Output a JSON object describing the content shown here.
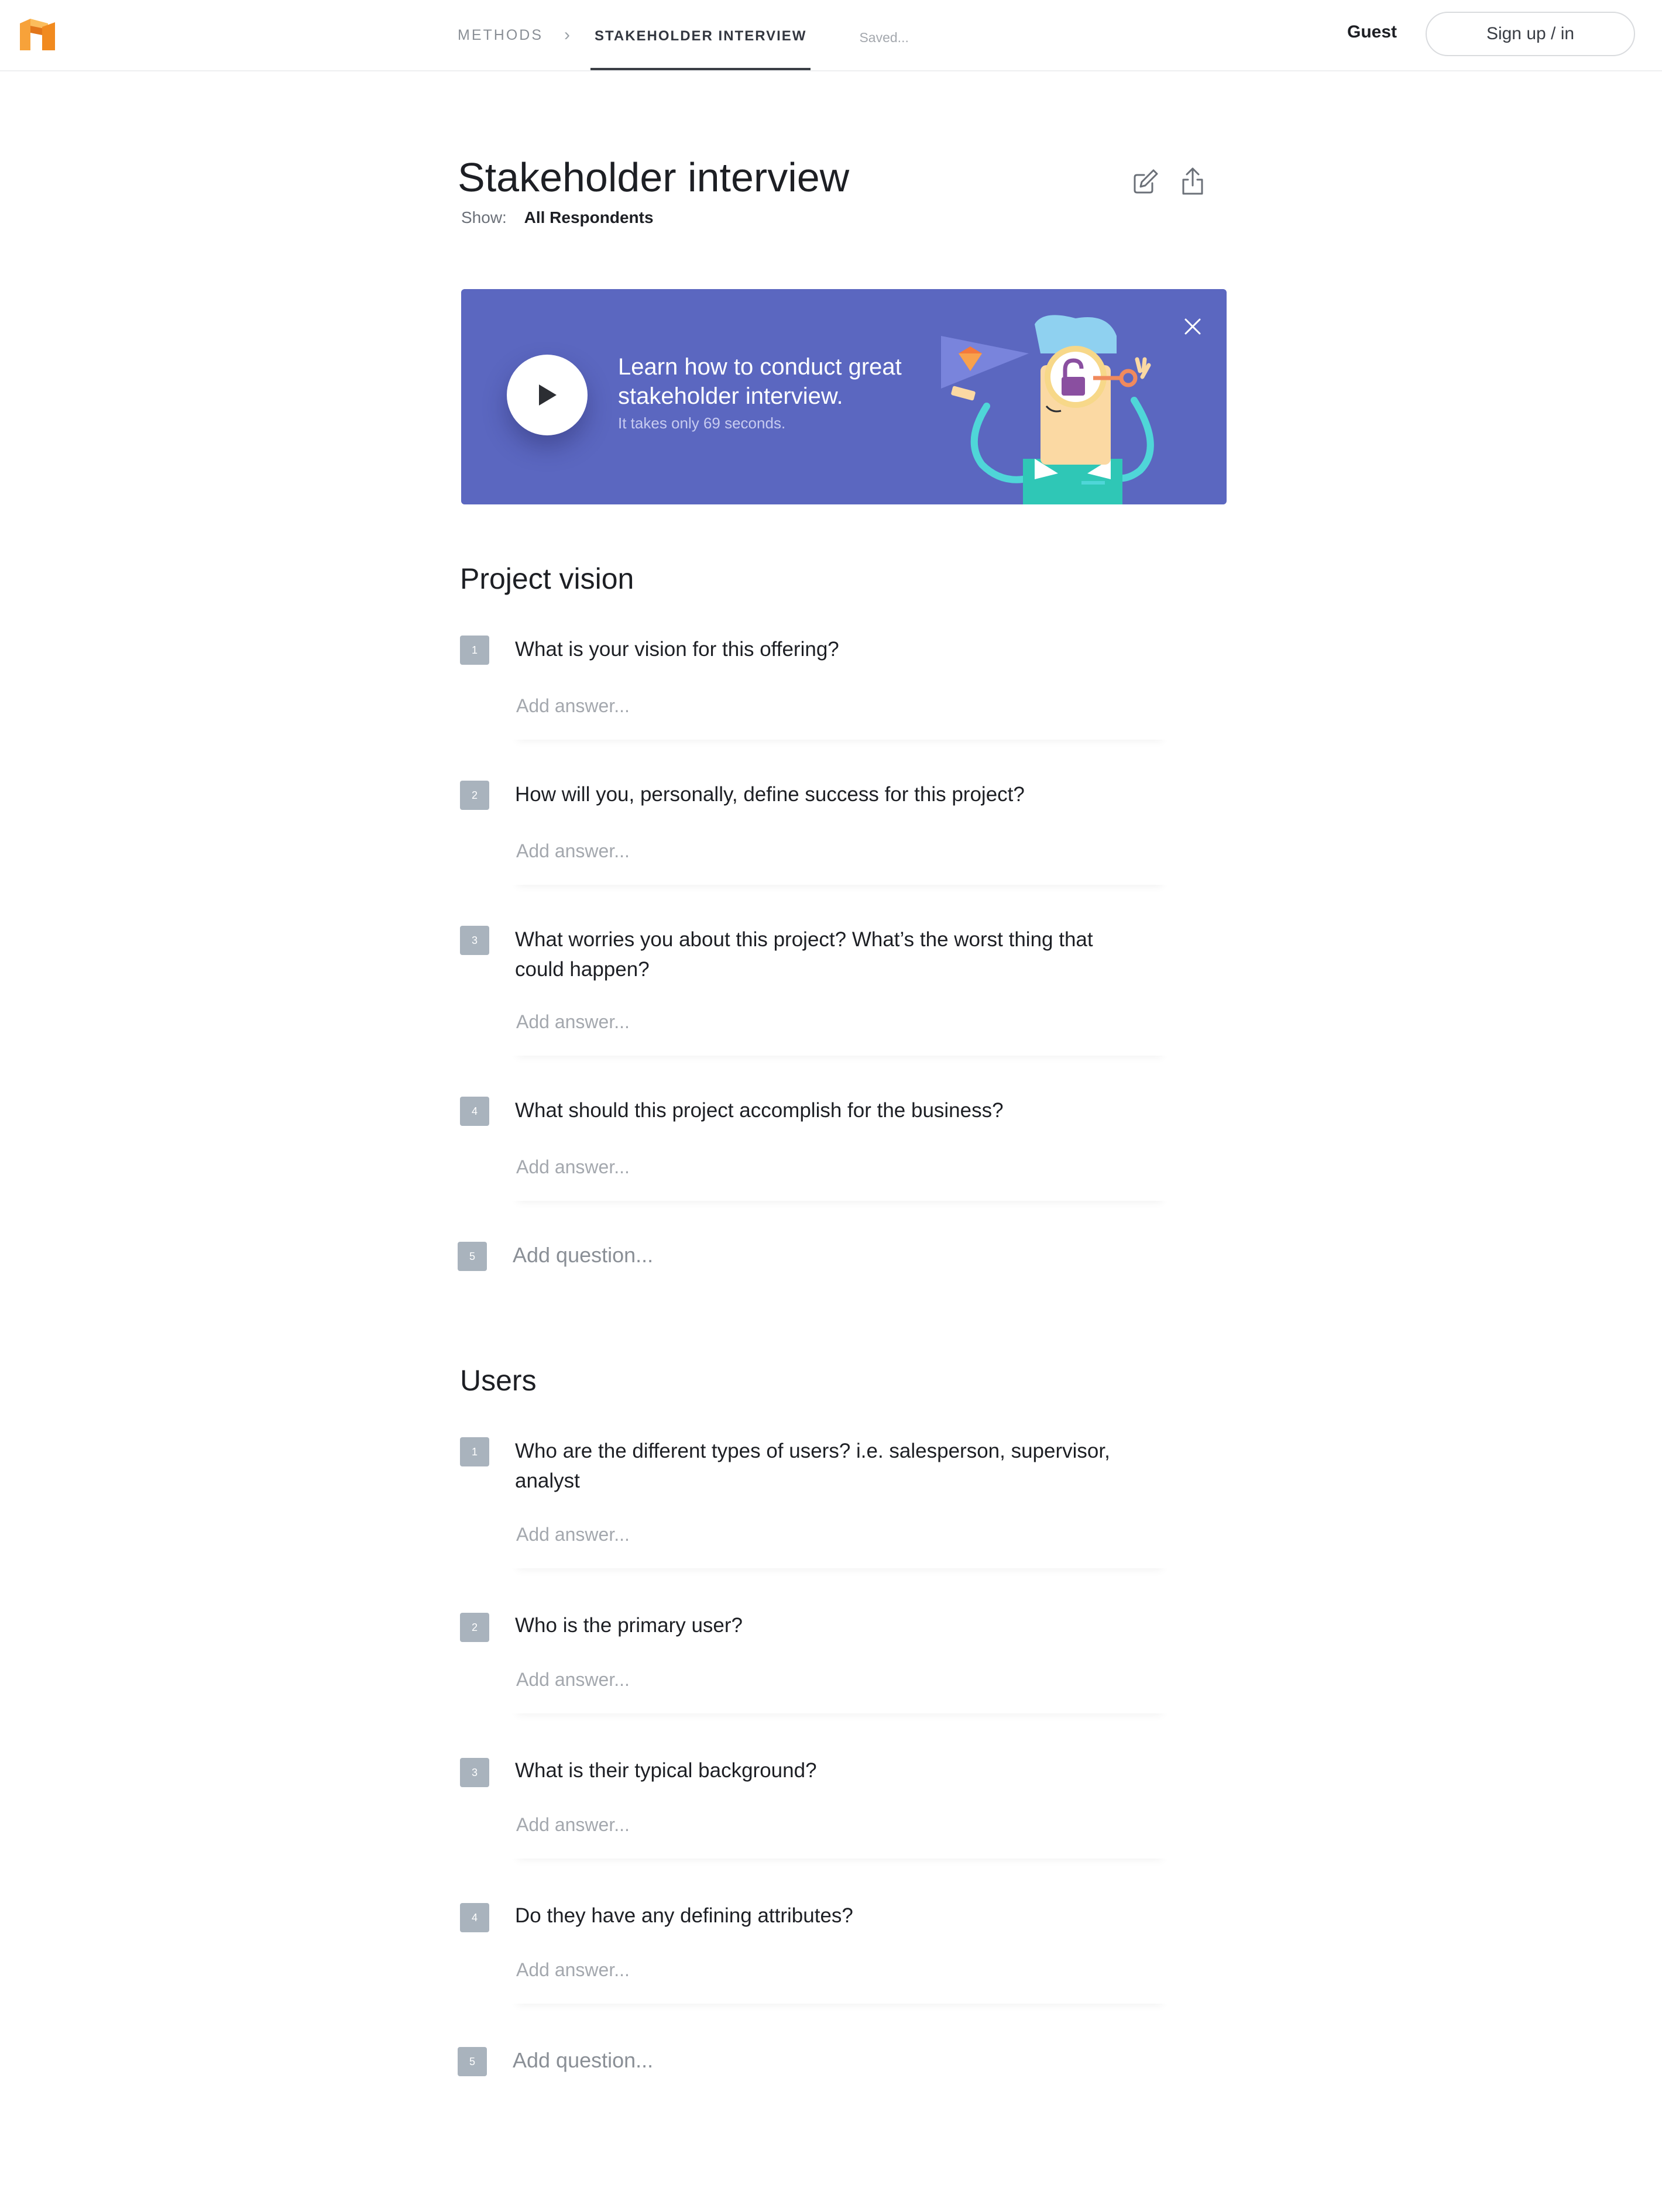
{
  "header": {
    "breadcrumb": {
      "methods": "METHODS",
      "separator": "›",
      "current": "STAKEHOLDER INTERVIEW"
    },
    "save_status": "Saved...",
    "user_label": "Guest",
    "signup_label": "Sign up / in"
  },
  "page": {
    "title": "Stakeholder interview",
    "show_label": "Show:",
    "show_value": "All Respondents"
  },
  "banner": {
    "title": "Learn how to conduct great stakeholder interview.",
    "subtitle": "It takes only 69 seconds.",
    "background_color": "#5b67c0"
  },
  "sections": [
    {
      "title": "Project vision",
      "questions": [
        {
          "number": "1",
          "text": "What is your vision for this offering?",
          "answer_placeholder": "Add answer..."
        },
        {
          "number": "2",
          "text": "How will you, personally, define success for this project?",
          "answer_placeholder": "Add answer..."
        },
        {
          "number": "3",
          "text": "What worries you about this project? What’s the worst thing that could happen?",
          "answer_placeholder": "Add answer..."
        },
        {
          "number": "4",
          "text": "What should this project accomplish for the business?",
          "answer_placeholder": "Add answer..."
        }
      ],
      "add_question": {
        "number": "5",
        "placeholder": "Add question..."
      }
    },
    {
      "title": "Users",
      "questions": [
        {
          "number": "1",
          "text": "Who are the different types of users? i.e. salesperson, supervisor, analyst",
          "answer_placeholder": "Add answer..."
        },
        {
          "number": "2",
          "text": "Who is the primary user?",
          "answer_placeholder": "Add answer..."
        },
        {
          "number": "3",
          "text": "What is their typical background?",
          "answer_placeholder": "Add answer..."
        },
        {
          "number": "4",
          "text": "Do they have any defining attributes?",
          "answer_placeholder": "Add answer..."
        }
      ],
      "add_question": {
        "number": "5",
        "placeholder": "Add question..."
      }
    }
  ],
  "icons": {
    "logo": "app-logo",
    "edit": "edit-icon",
    "share": "share-icon",
    "play": "play-icon",
    "close": "close-icon"
  },
  "colors": {
    "logo_orange": "#f39324",
    "badge_gray": "#a9b3bd",
    "banner_blue": "#5b67c0",
    "teal": "#2fc7b6"
  }
}
